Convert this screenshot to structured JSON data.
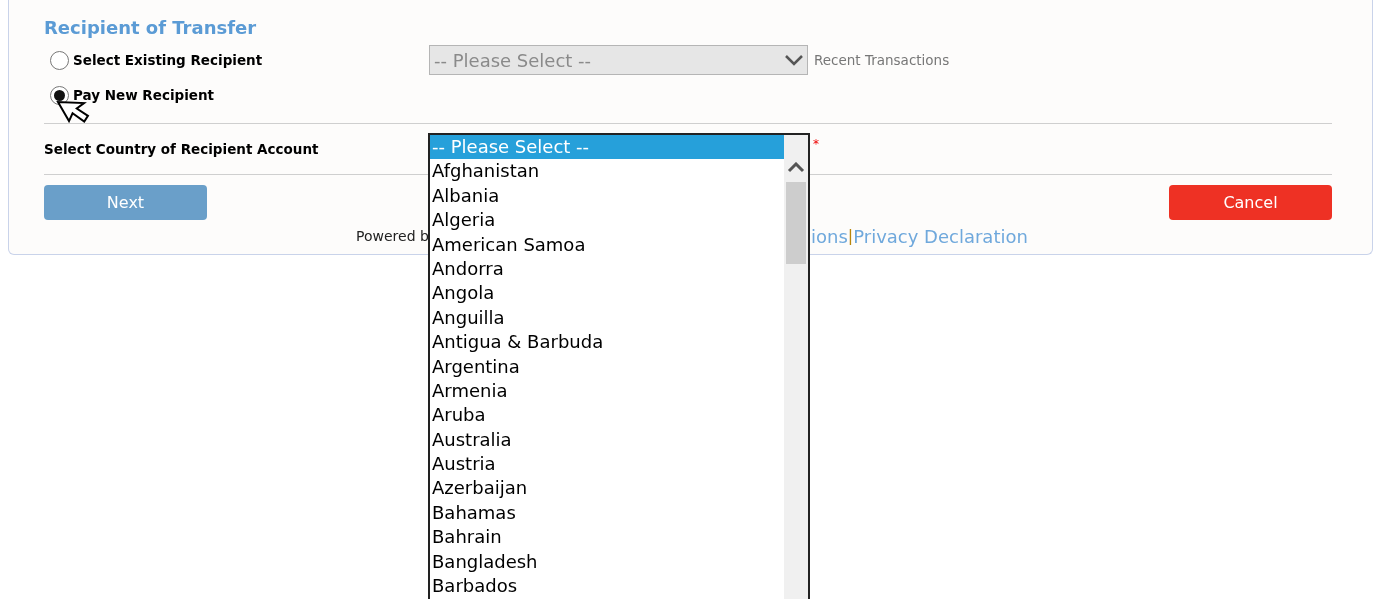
{
  "section": {
    "title": "Recipient of Transfer"
  },
  "recipient_options": [
    {
      "label": "Select Existing Recipient",
      "selected": false
    },
    {
      "label": "Pay New Recipient",
      "selected": true
    }
  ],
  "existing_recipient_select": {
    "value": "-- Please Select --",
    "disabled": true
  },
  "recent_transactions": "Recent Transactions",
  "country_field": {
    "label": "Select Country of Recipient Account",
    "required_mark": "*"
  },
  "buttons": {
    "next": {
      "label": "Next"
    },
    "cancel": {
      "label": "Cancel"
    }
  },
  "footer": {
    "powered_by": "Powered b",
    "link_fragment": "ions",
    "separator": "|",
    "privacy_link": "Privacy Declaration"
  },
  "country_list": [
    {
      "label": "-- Please Select --",
      "selected": true
    },
    {
      "label": "Afghanistan",
      "selected": false
    },
    {
      "label": "Albania",
      "selected": false
    },
    {
      "label": "Algeria",
      "selected": false
    },
    {
      "label": "American Samoa",
      "selected": false
    },
    {
      "label": "Andorra",
      "selected": false
    },
    {
      "label": "Angola",
      "selected": false
    },
    {
      "label": "Anguilla",
      "selected": false
    },
    {
      "label": "Antigua & Barbuda",
      "selected": false
    },
    {
      "label": "Argentina",
      "selected": false
    },
    {
      "label": "Armenia",
      "selected": false
    },
    {
      "label": "Aruba",
      "selected": false
    },
    {
      "label": "Australia",
      "selected": false
    },
    {
      "label": "Austria",
      "selected": false
    },
    {
      "label": "Azerbaijan",
      "selected": false
    },
    {
      "label": "Bahamas",
      "selected": false
    },
    {
      "label": "Bahrain",
      "selected": false
    },
    {
      "label": "Bangladesh",
      "selected": false
    },
    {
      "label": "Barbados",
      "selected": false
    }
  ]
}
